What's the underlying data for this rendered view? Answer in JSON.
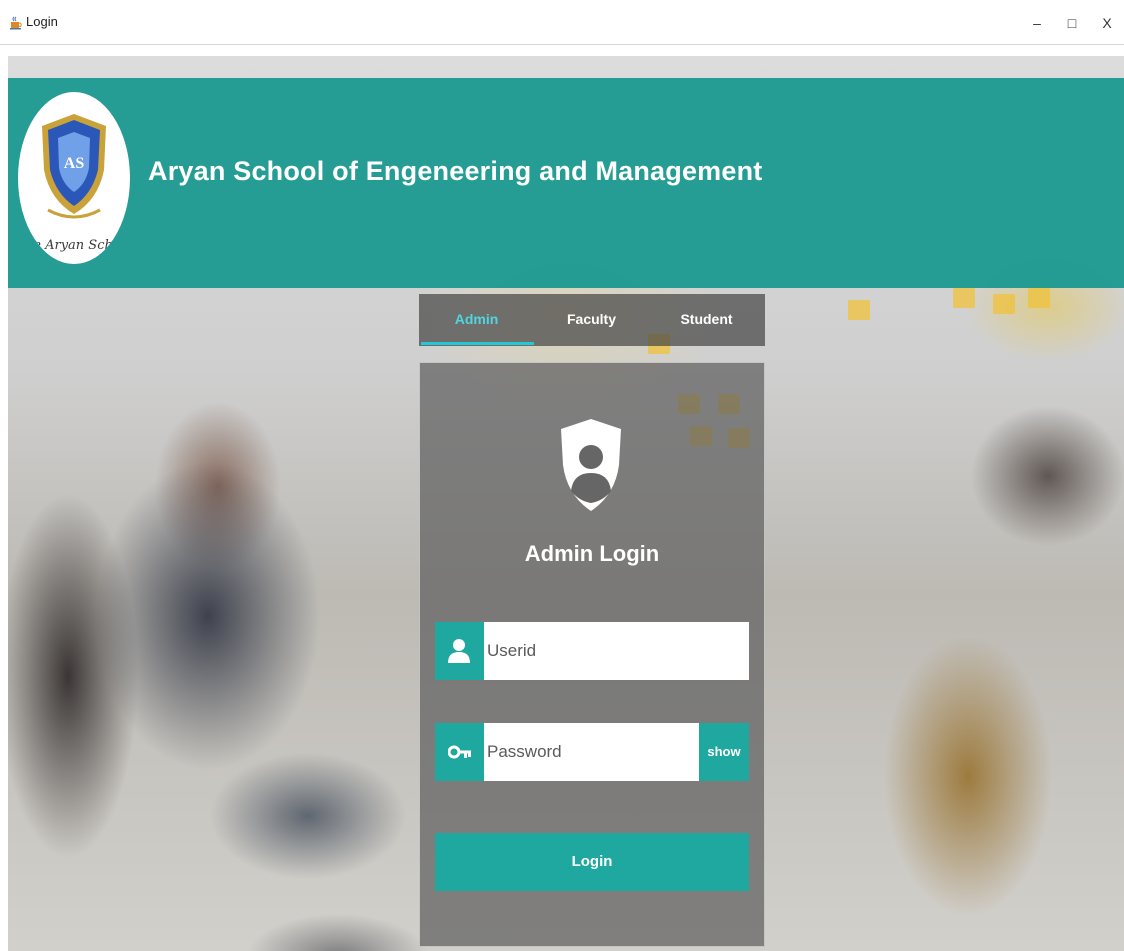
{
  "window": {
    "title": "Login",
    "minimize_glyph": "–",
    "maximize_glyph": "□",
    "close_glyph": "X"
  },
  "header": {
    "school_name": "Aryan School of Engeneering and Management",
    "logo_monogram": "AS",
    "logo_script": "e Aryan Scho"
  },
  "tabs": [
    {
      "label": "Admin",
      "active": true
    },
    {
      "label": "Faculty",
      "active": false
    },
    {
      "label": "Student",
      "active": false
    }
  ],
  "login": {
    "title": "Admin Login",
    "userid_placeholder": "Userid",
    "password_placeholder": "Password",
    "show_label": "show",
    "submit_label": "Login"
  },
  "icons": {
    "app": "java-cup-icon",
    "shield": "user-shield-icon",
    "user": "user-icon",
    "password": "key-icon"
  },
  "colors": {
    "accent": "#1fa89f",
    "banner": "#1f9a92",
    "active_tab": "#4fd6e0",
    "panel": "#5f5f5f"
  }
}
